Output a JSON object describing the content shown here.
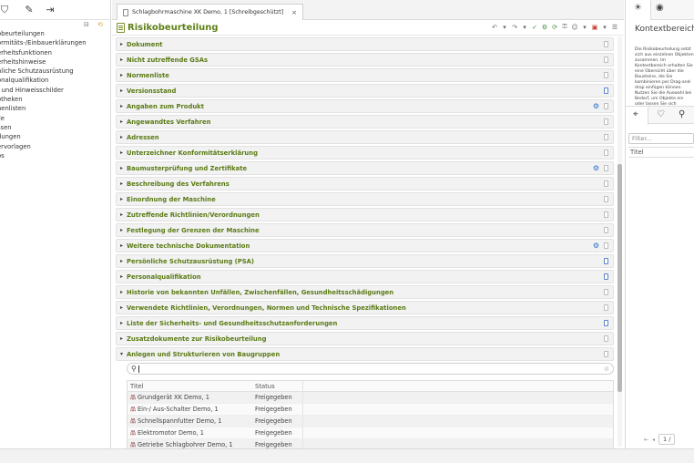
{
  "left": {
    "tree": [
      "obeurteilungen",
      "ormitäts-/Einbauerklärungen",
      "erheitsfunktionen",
      "erheitshinweise",
      "nliche Schutzausrüstung",
      "onalqualifikation",
      "- und Hinweisschilder",
      "otheken",
      "nenlisten",
      "lle",
      "ssen",
      "dungen",
      "ervorlagen",
      "os"
    ]
  },
  "editor": {
    "tab_label": "Schlagbohrmaschine XK Demo, 1 [Schreibgeschützt]",
    "tab_close": "×",
    "title": "Risikobeurteilung",
    "sections": [
      {
        "label": "Dokument",
        "icon": "doc"
      },
      {
        "label": "Nicht zutreffende GSAs",
        "icon": "doc"
      },
      {
        "label": "Normenliste",
        "icon": "doc"
      },
      {
        "label": "Versionsstand",
        "icon": "doc-blue"
      },
      {
        "label": "Angaben zum Produkt",
        "icon": "gear"
      },
      {
        "label": "Angewandtes Verfahren",
        "icon": "doc"
      },
      {
        "label": "Adressen",
        "icon": "doc"
      },
      {
        "label": "Unterzeichner Konformitätserklärung",
        "icon": "doc"
      },
      {
        "label": "Baumusterprüfung und Zertifikate",
        "icon": "gear"
      },
      {
        "label": "Beschreibung des Verfahrens",
        "icon": "doc"
      },
      {
        "label": "Einordnung der Maschine",
        "icon": "doc"
      },
      {
        "label": "Zutreffende Richtlinien/Verordnungen",
        "icon": "doc"
      },
      {
        "label": "Festlegung der Grenzen der Maschine",
        "icon": "doc"
      },
      {
        "label": "Weitere technische Dokumentation",
        "icon": "gear"
      },
      {
        "label": "Persönliche Schutzausrüstung (PSA)",
        "icon": "doc-blue"
      },
      {
        "label": "Personalqualifikation",
        "icon": "doc-blue"
      },
      {
        "label": "Historie von bekannten Unfällen, Zwischenfällen, Gesundheitsschädigungen",
        "icon": "doc"
      },
      {
        "label": "Verwendete Richtlinien, Verordnungen, Normen und Technische Spezifikationen",
        "icon": "doc"
      },
      {
        "label": "Liste der Sicherheits- und Gesundheitsschutzanforderungen",
        "icon": "doc-blue"
      },
      {
        "label": "Zusatzdokumente zur Risikobeurteilung",
        "icon": "doc"
      },
      {
        "label": "Anlegen und Strukturieren von Baugruppen",
        "icon": "doc",
        "expanded": true
      }
    ],
    "grid": {
      "columns": [
        "Titel",
        "Status"
      ],
      "rows": [
        {
          "title": "Grundgerät XK Demo, 1",
          "status": "Freigegeben",
          "icon": "tree"
        },
        {
          "title": "Ein-/ Aus-Schalter Demo, 1",
          "status": "Freigegeben",
          "icon": "tree"
        },
        {
          "title": "Schnellspannfutter Demo, 1",
          "status": "Freigegeben",
          "icon": "tree"
        },
        {
          "title": "Elektromotor Demo, 1",
          "status": "Freigegeben",
          "icon": "tree"
        },
        {
          "title": "Getriebe Schlagbohrer Demo, 1",
          "status": "Freigegeben",
          "icon": "tree"
        }
      ]
    }
  },
  "right": {
    "title": "Kontextbereich",
    "description": "Die Risikobeurteilung setzt sich aus einzelnen Objekten zusammen. Im Kontextbereich erhalten Sie eine Übersicht über die Bausteine, die Sie kombinieren per Drag-and-drop einfügen können. Nutzen Sie die Auswahl bei Bedarf, um Objekte ein oder lassen Sie sich lediglich die Inhalte anzeigen. Außerdem können Sie über „Suche“ nach Objekten suchen.",
    "filter_placeholder": "Filter...",
    "column": "Titel",
    "page": "1 /"
  }
}
